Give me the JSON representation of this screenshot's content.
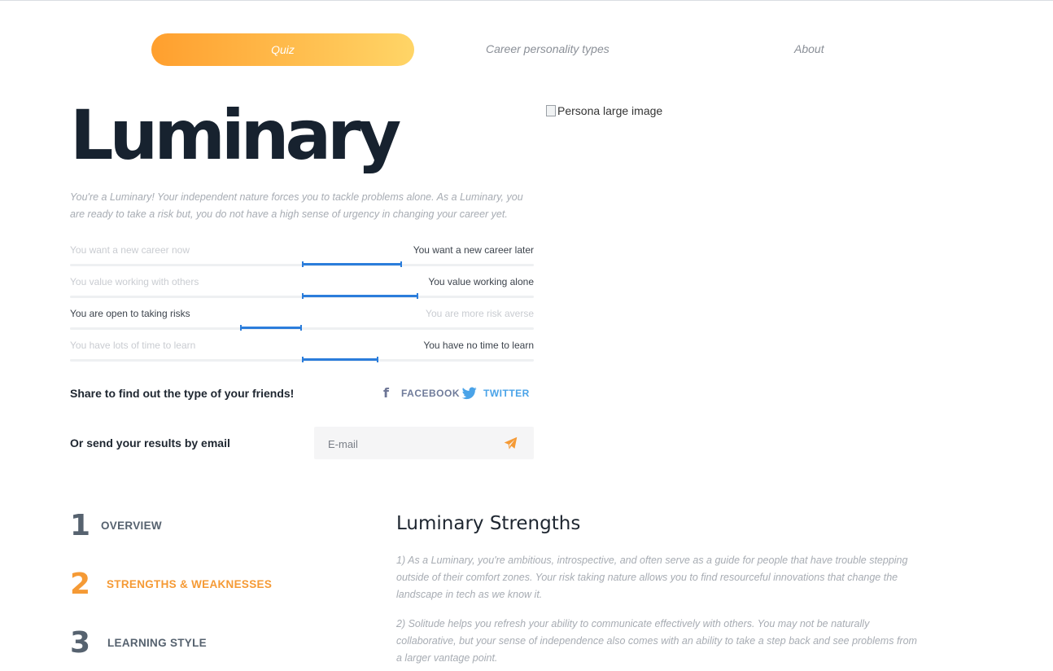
{
  "nav": {
    "active_label": "Quiz",
    "link_1": "Career personality types",
    "link_2": "About"
  },
  "hero": {
    "title": "Luminary",
    "description": "You're a Luminary! Your independent nature forces you to tackle problems alone. As a Luminary, you are ready to take a risk but, you do not have a high sense of urgency in changing your career yet.",
    "image_alt": "Persona large image"
  },
  "sliders": [
    {
      "left": "You want a new career now",
      "right": "You want a new career later",
      "leans": "right",
      "from": 0.5,
      "to": 0.715
    },
    {
      "left": "You value working with others",
      "right": "You value working alone",
      "leans": "right",
      "from": 0.5,
      "to": 0.75
    },
    {
      "left": "You are open to taking risks",
      "right": "You are more risk averse",
      "leans": "left",
      "from": 0.367,
      "to": 0.5
    },
    {
      "left": "You have lots of time to learn",
      "right": "You have no time to learn",
      "leans": "right",
      "from": 0.5,
      "to": 0.665
    }
  ],
  "share": {
    "label": "Share to find out the type of your friends!",
    "facebook": "FACEBOOK",
    "twitter": "TWITTER"
  },
  "email": {
    "label": "Or send your results by email",
    "placeholder": "E-mail"
  },
  "sections": [
    {
      "num": "1",
      "label": "OVERVIEW",
      "active": false
    },
    {
      "num": "2",
      "label": "STRENGTHS & WEAKNESSES",
      "active": true
    },
    {
      "num": "3",
      "label": "LEARNING STYLE",
      "active": false
    }
  ],
  "strengths": {
    "title": "Luminary Strengths",
    "p1": "1) As a Luminary, you're ambitious, introspective, and often serve as a guide for people that have trouble stepping outside of their comfort zones. Your risk  taking nature allows you to find resourceful innovations that change the landscape in tech as we know it.",
    "p2": "2) Solitude helps you refresh your ability to communicate effectively with others. You may not be naturally collaborative, but your sense of independence also comes with an ability to take a step back and see problems from a larger vantage point."
  },
  "colors": {
    "accent_orange": "#f59a35",
    "gradient_start": "#ff9f2e",
    "gradient_end": "#ffd567",
    "slider_blue": "#2b7ddb",
    "heading_dark": "#17222f",
    "twitter_blue": "#4aa3e8",
    "facebook_slate": "#6f7b9a"
  },
  "icons": {
    "facebook": "facebook-icon",
    "twitter": "twitter-icon",
    "send": "paper-plane-icon",
    "broken_image": "broken-image-icon"
  }
}
